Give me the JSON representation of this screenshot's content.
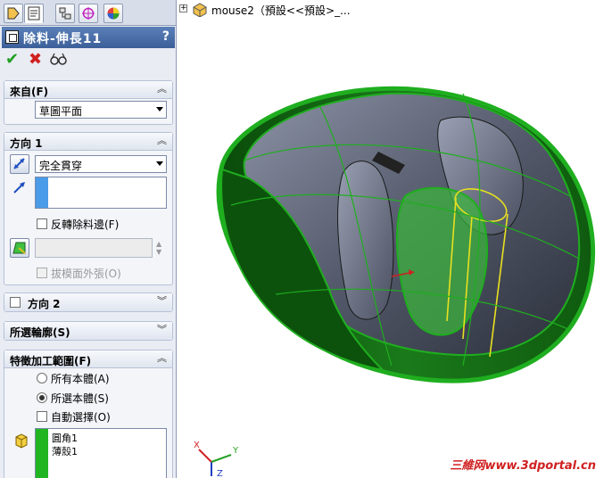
{
  "feature_manager": {
    "title": "除料-伸長11",
    "help": "?",
    "ok": "✔",
    "cancel": "✖",
    "preview": "👓"
  },
  "groups": {
    "from": {
      "title": "來自(F)",
      "selected": "草圖平面"
    },
    "direction1": {
      "title": "方向 1",
      "end_condition": "完全貫穿",
      "flip_side": "反轉除料邊(F)",
      "draft_outward": "拔模面外張(O)"
    },
    "direction2": {
      "title": "方向 2"
    },
    "selected_contours": {
      "title": "所選輪廓(S)"
    },
    "feature_scope": {
      "title": "特徵加工範圍(F)",
      "all_bodies": "所有本體(A)",
      "selected_bodies": "所選本體(S)",
      "auto_select": "自動選擇(O)",
      "bodies": [
        "圓角1",
        "薄殼1"
      ]
    }
  },
  "viewport": {
    "breadcrumb": "mouse2（預設<<預設>_..."
  },
  "watermark": "三維网www.3dportal.cn",
  "colors": {
    "title_bar": "#3c5f9a",
    "selection_green": "#1fae1f",
    "panel_bg": "#e9ecf3",
    "watermark": "#d02020"
  }
}
